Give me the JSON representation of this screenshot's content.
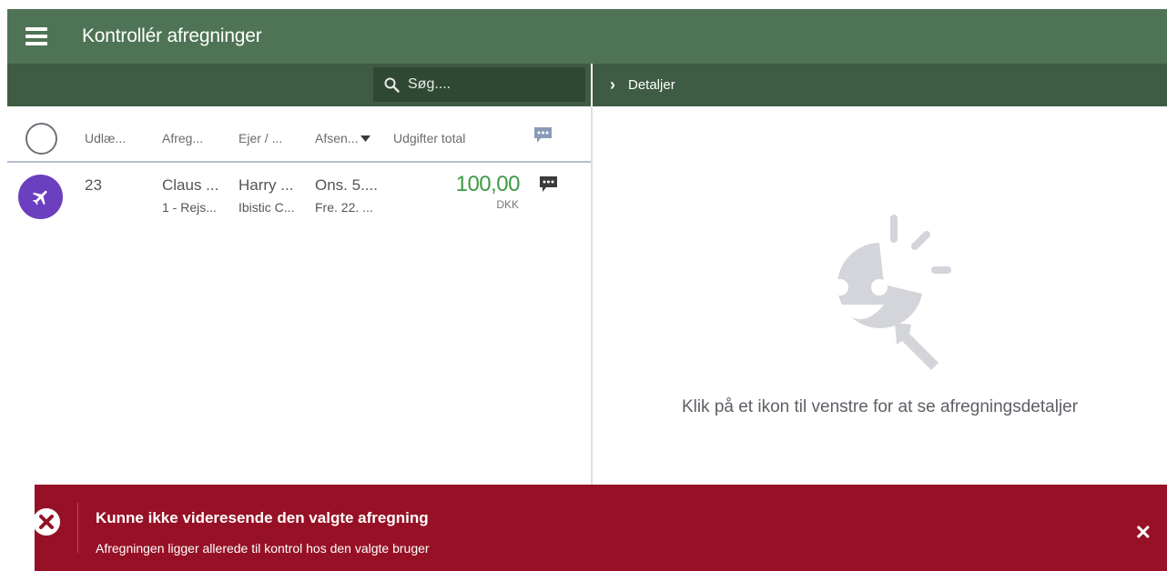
{
  "header": {
    "title": "Kontrollér afregninger"
  },
  "search": {
    "placeholder": "Søg...."
  },
  "details": {
    "label": "Detaljer"
  },
  "columns": {
    "udlaeg": "Udlæ...",
    "afregning": "Afreg...",
    "ejer": "Ejer / ...",
    "afsendt": "Afsen...",
    "udgifter": "Udgifter total"
  },
  "rows": [
    {
      "type_icon": "airplane-icon",
      "id": "23",
      "afregning_main": "Claus ...",
      "afregning_sub": "1 - Rejs...",
      "ejer_main": "Harry ...",
      "ejer_sub": "Ibistic C...",
      "afsendt_main": "Ons. 5....",
      "afsendt_sub": "Fre. 22. ...",
      "amount": "100,00",
      "currency": "DKK"
    }
  ],
  "empty_state": {
    "text": "Klik på et ikon til venstre for at se afregningsdetaljer"
  },
  "error": {
    "title": "Kunne ikke videresende den valgte afregning",
    "message": "Afregningen ligger allerede til kontrol hos den valgte bruger",
    "close_label": "✕"
  },
  "colors": {
    "topbar": "#4e7455",
    "subbar": "#3e5c44",
    "accent_purple": "#6b3fc0",
    "amount_green": "#3c9b45",
    "error_red": "#971126"
  }
}
